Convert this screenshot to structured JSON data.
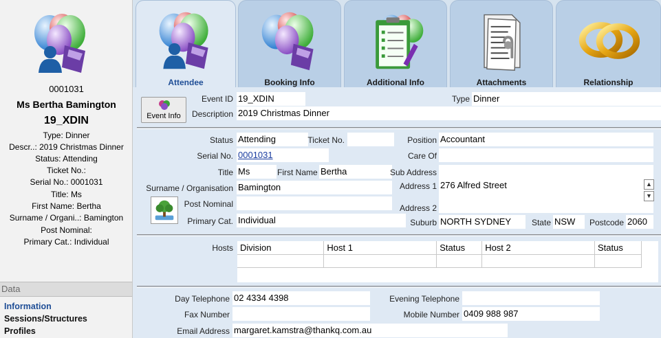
{
  "summary": {
    "serial": "0001031",
    "name": "Ms Bertha Bamington",
    "event_code": "19_XDIN",
    "lines": [
      "Type: Dinner",
      "Descr..: 2019 Christmas Dinner",
      "Status: Attending",
      "Ticket No.:",
      "Serial No.: 0001031",
      "Title: Ms",
      "First Name: Bertha",
      "Surname / Organi..: Bamington",
      "Post Nominal:",
      "Primary Cat.: Individual"
    ]
  },
  "nav": {
    "header": "Data",
    "items": [
      "Information",
      "Sessions/Structures",
      "Profiles"
    ]
  },
  "tabs": [
    {
      "label": "Attendee",
      "icon": "attendee-balloons-icon",
      "active": true
    },
    {
      "label": "Booking Info",
      "icon": "balloons-icon",
      "active": false
    },
    {
      "label": "Additional Info",
      "icon": "clipboard-checklist-icon",
      "active": false
    },
    {
      "label": "Attachments",
      "icon": "paperclip-documents-icon",
      "active": false
    },
    {
      "label": "Relationship",
      "icon": "wedding-rings-icon",
      "active": false
    }
  ],
  "event": {
    "button_label": "Event Info",
    "event_id_label": "Event ID",
    "event_id": "19_XDIN",
    "type_label": "Type",
    "type": "Dinner",
    "description_label": "Description",
    "description": "2019 Christmas Dinner"
  },
  "attendee": {
    "status_label": "Status",
    "status": "Attending",
    "ticket_label": "Ticket No.",
    "ticket": "",
    "serial_label": "Serial No.",
    "serial": "0001031",
    "title_label": "Title",
    "title": "Ms",
    "first_name_label": "First Name",
    "first_name": "Bertha",
    "surname_label": "Surname / Organisation",
    "surname": "Bamington",
    "post_nominal_label": "Post Nominal",
    "post_nominal": "",
    "primary_cat_label": "Primary Cat.",
    "primary_cat": "Individual",
    "position_label": "Position",
    "position": "Accountant",
    "care_of_label": "Care Of",
    "care_of": "",
    "sub_address_label": "Sub Address",
    "sub_address": "",
    "address1_label": "Address 1",
    "address1": "276 Alfred Street",
    "address2_label": "Address 2",
    "address2": "",
    "suburb_label": "Suburb",
    "suburb": "NORTH SYDNEY",
    "state_label": "State",
    "state": "NSW",
    "postcode_label": "Postcode",
    "postcode": "2060"
  },
  "hosts": {
    "label": "Hosts",
    "columns": [
      "Division",
      "Host 1",
      "Status",
      "Host 2",
      "Status"
    ],
    "rows": [
      [
        "",
        "",
        "",
        "",
        ""
      ]
    ]
  },
  "contact": {
    "day_phone_label": "Day Telephone",
    "day_phone": "02 4334 4398",
    "evening_phone_label": "Evening Telephone",
    "evening_phone": "",
    "fax_label": "Fax Number",
    "fax": "",
    "mobile_label": "Mobile Number",
    "mobile": "0409 988 987",
    "email_label": "Email Address",
    "email": "margaret.kamstra@thankq.com.au"
  },
  "colors": {
    "panel_bg": "#f2f2f2",
    "form_bg": "#dfe9f4",
    "tab_bg": "#b9cfe6",
    "active_tab_text": "#1f4e96",
    "link": "#1a3ca0"
  }
}
